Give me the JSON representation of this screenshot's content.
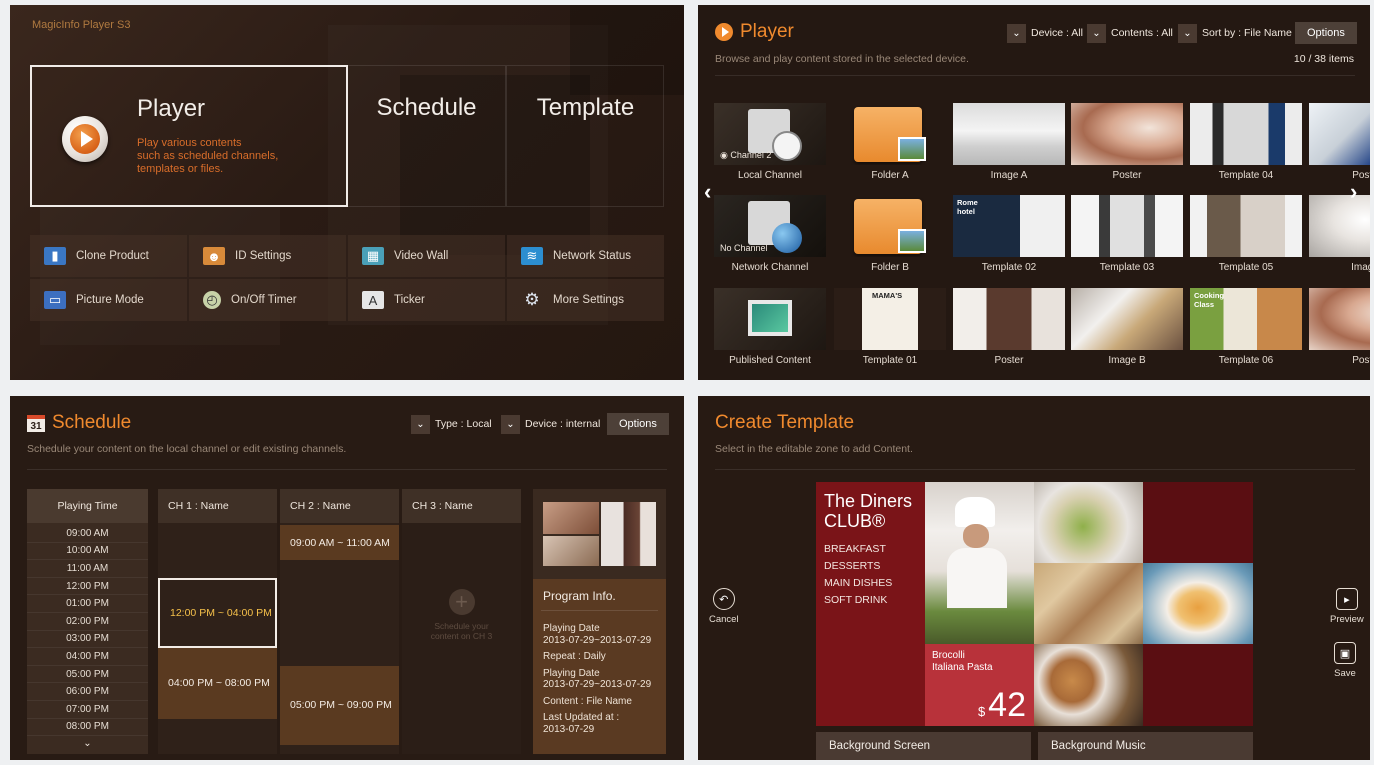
{
  "home": {
    "brand": "MagicInfo Player S3",
    "menu": [
      {
        "title": "Player",
        "desc": [
          "Play various contents",
          "such as scheduled channels,",
          "templates or files."
        ]
      },
      {
        "title": "Schedule"
      },
      {
        "title": "Template"
      }
    ],
    "quick": [
      {
        "label": "Clone Product",
        "icon": "clone-icon"
      },
      {
        "label": "ID Settings",
        "icon": "id-icon"
      },
      {
        "label": "Video Wall",
        "icon": "video-wall-icon"
      },
      {
        "label": "Network Status",
        "icon": "network-icon"
      },
      {
        "label": "Picture Mode",
        "icon": "monitor-icon"
      },
      {
        "label": "On/Off Timer",
        "icon": "clock-icon"
      },
      {
        "label": "Ticker",
        "icon": "ticker-icon"
      },
      {
        "label": "More Settings",
        "icon": "gear-icon"
      }
    ]
  },
  "player": {
    "title": "Player",
    "subtitle": "Browse and play content stored in the selected device.",
    "filters": {
      "device": "Device : All",
      "contents": "Contents : All",
      "sort": "Sort by : File Name"
    },
    "options": "Options",
    "count": "10 / 38 items",
    "tiles": [
      {
        "label": "Local Channel",
        "overlay": "Channel 2",
        "kind": "channel"
      },
      {
        "label": "Folder A",
        "kind": "folder"
      },
      {
        "label": "Image A",
        "kind": "room"
      },
      {
        "label": "Poster",
        "kind": "hair"
      },
      {
        "label": "Template 04",
        "kind": "kitchen"
      },
      {
        "label": "Poste",
        "kind": "man"
      },
      {
        "label": "Network Channel",
        "overlay": "No Channel",
        "kind": "netchannel"
      },
      {
        "label": "Folder B",
        "kind": "folder"
      },
      {
        "label": "Template 02",
        "kind": "hotel",
        "caption": "Rome hotel"
      },
      {
        "label": "Template 03",
        "kind": "people"
      },
      {
        "label": "Template 05",
        "kind": "kitchen2"
      },
      {
        "label": "Image",
        "kind": "chef"
      },
      {
        "label": "Published Content",
        "kind": "published"
      },
      {
        "label": "Template 01",
        "kind": "menu",
        "caption": "MAMA'S"
      },
      {
        "label": "Poster",
        "kind": "woman"
      },
      {
        "label": "Image B",
        "kind": "chefs"
      },
      {
        "label": "Template 06",
        "kind": "cooking",
        "caption": "Cooking Class"
      },
      {
        "label": "Poste",
        "kind": "hair"
      }
    ]
  },
  "schedule": {
    "title": "Schedule",
    "icon_day": "31",
    "subtitle": "Schedule your content on the local channel or edit existing channels.",
    "filters": {
      "type": "Type : Local",
      "device": "Device : internal"
    },
    "options": "Options",
    "playing_time_header": "Playing Time",
    "times": [
      "09:00 AM",
      "10:00 AM",
      "11:00 AM",
      "12:00 PM",
      "01:00 PM",
      "02:00 PM",
      "03:00 PM",
      "04:00 PM",
      "05:00 PM",
      "06:00 PM",
      "07:00 PM",
      "08:00 PM"
    ],
    "channels": [
      {
        "name": "CH 1 : Name",
        "blocks": [
          {
            "text": "12:00 PM ~ 04:00 PM",
            "start": 3,
            "end": 7,
            "selected": true
          },
          {
            "text": "04:00 PM ~ 08:00 PM",
            "start": 7,
            "end": 11
          }
        ]
      },
      {
        "name": "CH 2 : Name",
        "blocks": [
          {
            "text": "09:00 AM ~ 11:00 AM",
            "start": 0,
            "end": 2
          },
          {
            "text": "05:00 PM ~ 09:00 PM",
            "start": 8,
            "end": 12.5
          }
        ]
      },
      {
        "name": "CH 3 : Name",
        "empty_text": "Schedule your content on CH 3"
      }
    ],
    "program_info": {
      "title": "Program Info.",
      "lines": [
        "Playing Date",
        "2013-07-29~2013-07-29",
        "Repeat : Daily",
        "Playing Date",
        "2013-07-29~2013-07-29",
        "Content : File Name",
        "Last Updated at :",
        "2013-07-29"
      ]
    }
  },
  "template": {
    "title": "Create Template",
    "subtitle": "Select in the editable zone to add Content.",
    "cancel": "Cancel",
    "preview": "Preview",
    "save": "Save",
    "bg_screen": "Background Screen",
    "bg_music": "Background Music",
    "canvas": {
      "headline1": "The Diners",
      "headline2": "CLUB®",
      "menu": [
        "BREAKFAST",
        "DESSERTS",
        "MAIN DISHES",
        "SOFT DRINK"
      ],
      "dish1": "Brocolli",
      "dish2": "Italiana Pasta",
      "currency": "$",
      "price": "42"
    }
  },
  "colors": {
    "accent": "#f08a2e",
    "bg": "#2b1d16",
    "maroon": "#7a1418"
  }
}
